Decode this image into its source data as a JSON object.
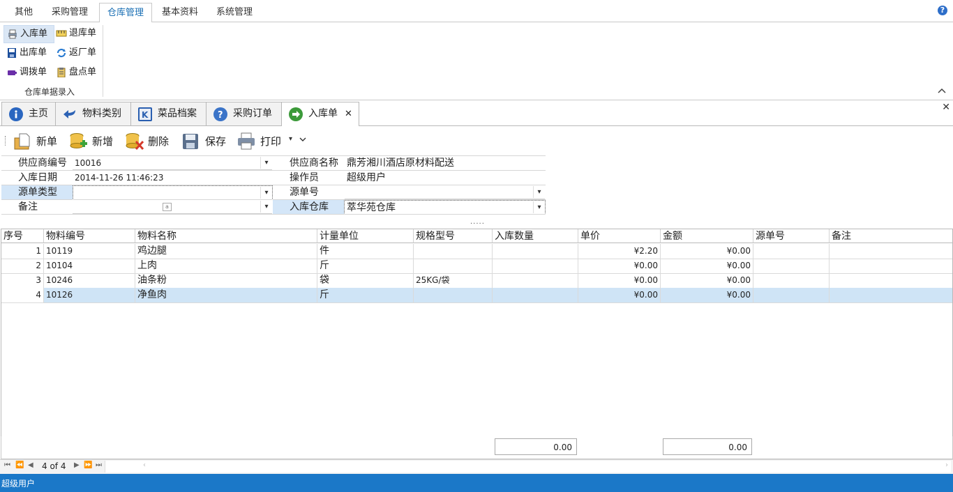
{
  "ribbon": {
    "tabs": [
      {
        "label": "其他"
      },
      {
        "label": "采购管理"
      },
      {
        "label": "仓库管理",
        "active": true
      },
      {
        "label": "基本资料"
      },
      {
        "label": "系统管理"
      }
    ],
    "group": {
      "label": "仓库单据录入",
      "buttons": [
        {
          "label": "入库单",
          "icon": "printer-icon"
        },
        {
          "label": "退库单",
          "icon": "ruler-icon"
        },
        {
          "label": "出库单",
          "icon": "floppy-icon"
        },
        {
          "label": "返厂单",
          "icon": "refresh-icon"
        },
        {
          "label": "调拨单",
          "icon": "battery-icon"
        },
        {
          "label": "盘点单",
          "icon": "clipboard-icon"
        }
      ]
    }
  },
  "doc_tabs": [
    {
      "label": "主页",
      "icon": "info-icon"
    },
    {
      "label": "物料类别",
      "icon": "back-arrow-icon"
    },
    {
      "label": "菜品档案",
      "icon": "k-icon"
    },
    {
      "label": "采购订单",
      "icon": "help-icon"
    },
    {
      "label": "入库单",
      "icon": "forward-arrow-icon",
      "active": true
    }
  ],
  "toolbar": {
    "new_doc": "新单",
    "add": "新增",
    "delete": "删除",
    "save": "保存",
    "print": "打印"
  },
  "form": {
    "supplier_code_label": "供应商编号",
    "supplier_code": "10016",
    "supplier_name_label": "供应商名称",
    "supplier_name": "鼎芳湘川酒店原材料配送",
    "date_label": "入库日期",
    "date": "2014-11-26 11:46:23",
    "operator_label": "操作员",
    "operator": "超级用户",
    "source_type_label": "源单类型",
    "source_type": "",
    "source_no_label": "源单号",
    "source_no": "",
    "remark_label": "备注",
    "remark": "",
    "warehouse_label": "入库仓库",
    "warehouse": "萃华苑仓库"
  },
  "grid": {
    "columns": [
      "序号",
      "物料编号",
      "物料名称",
      "计量单位",
      "规格型号",
      "入库数量",
      "单价",
      "金额",
      "源单号",
      "备注"
    ],
    "rows": [
      {
        "idx": "1",
        "code": "10119",
        "name": "鸡边腿",
        "unit": "件",
        "spec": "",
        "qty": "",
        "price": "¥2.20",
        "amount": "¥0.00",
        "src": "",
        "remark": ""
      },
      {
        "idx": "2",
        "code": "10104",
        "name": "上肉",
        "unit": "斤",
        "spec": "",
        "qty": "",
        "price": "¥0.00",
        "amount": "¥0.00",
        "src": "",
        "remark": ""
      },
      {
        "idx": "3",
        "code": "10246",
        "name": "油条粉",
        "unit": "袋",
        "spec": "25KG/袋",
        "qty": "",
        "price": "¥0.00",
        "amount": "¥0.00",
        "src": "",
        "remark": ""
      },
      {
        "idx": "4",
        "code": "10126",
        "name": "净鱼肉",
        "unit": "斤",
        "spec": "",
        "qty": "",
        "price": "¥0.00",
        "amount": "¥0.00",
        "src": "",
        "remark": "",
        "selected": true
      }
    ],
    "total_qty": "0.00",
    "total_amount": "0.00"
  },
  "navigator": {
    "position": "4 of 4"
  },
  "status": {
    "user": "超级用户"
  },
  "colors": {
    "accent": "#1b78c8",
    "selection": "#cfe4f6",
    "highlight_label": "#d4e6f8"
  }
}
